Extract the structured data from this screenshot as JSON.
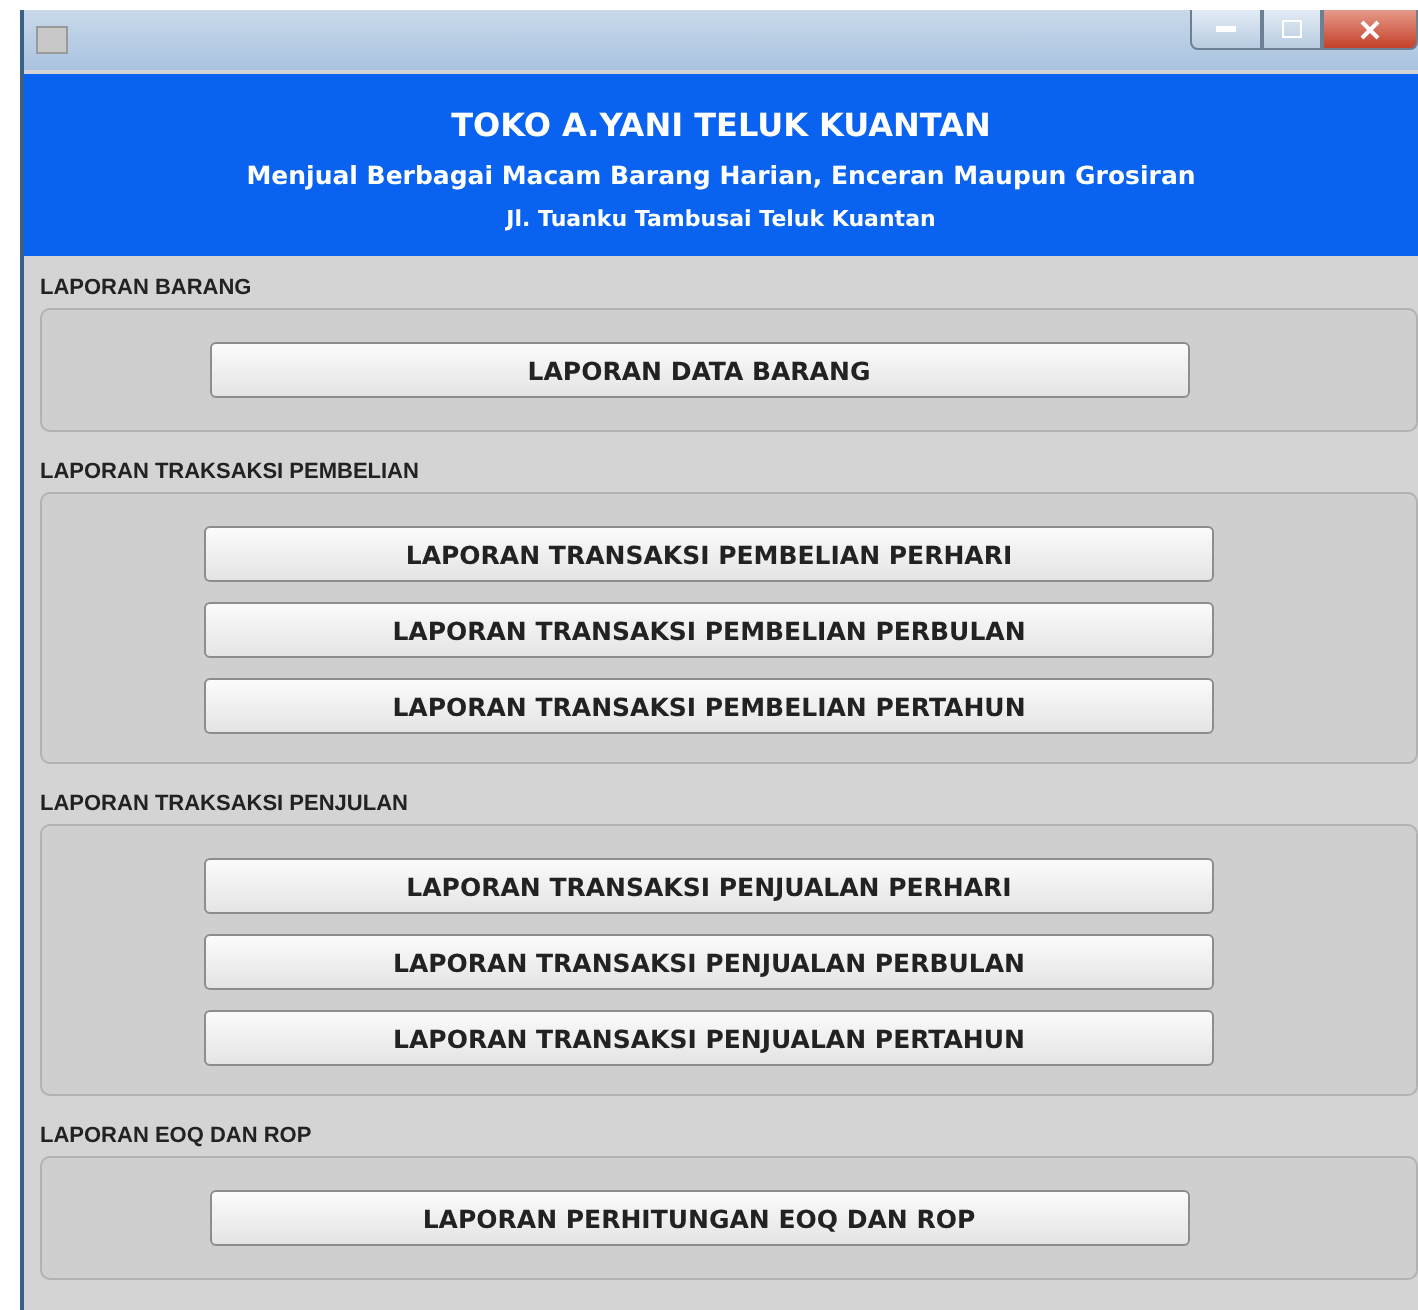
{
  "header": {
    "title": "TOKO A.YANI TELUK KUANTAN",
    "subtitle": "Menjual Berbagai Macam Barang Harian, Enceran Maupun Grosiran",
    "address": "Jl. Tuanku Tambusai Teluk Kuantan"
  },
  "sections": [
    {
      "label": "LAPORAN BARANG",
      "buttons": [
        "LAPORAN DATA BARANG"
      ]
    },
    {
      "label": "LAPORAN TRAKSAKSI PEMBELIAN",
      "buttons": [
        "LAPORAN TRANSAKSI PEMBELIAN PERHARI",
        "LAPORAN TRANSAKSI PEMBELIAN PERBULAN",
        "LAPORAN TRANSAKSI PEMBELIAN PERTAHUN"
      ]
    },
    {
      "label": "LAPORAN TRAKSAKSI PENJULAN",
      "buttons": [
        "LAPORAN TRANSAKSI PENJUALAN PERHARI",
        "LAPORAN TRANSAKSI PENJUALAN PERBULAN",
        "LAPORAN TRANSAKSI PENJUALAN PERTAHUN"
      ]
    },
    {
      "label": "LAPORAN EOQ DAN ROP",
      "buttons": [
        "LAPORAN PERHITUNGAN EOQ DAN ROP"
      ]
    }
  ]
}
